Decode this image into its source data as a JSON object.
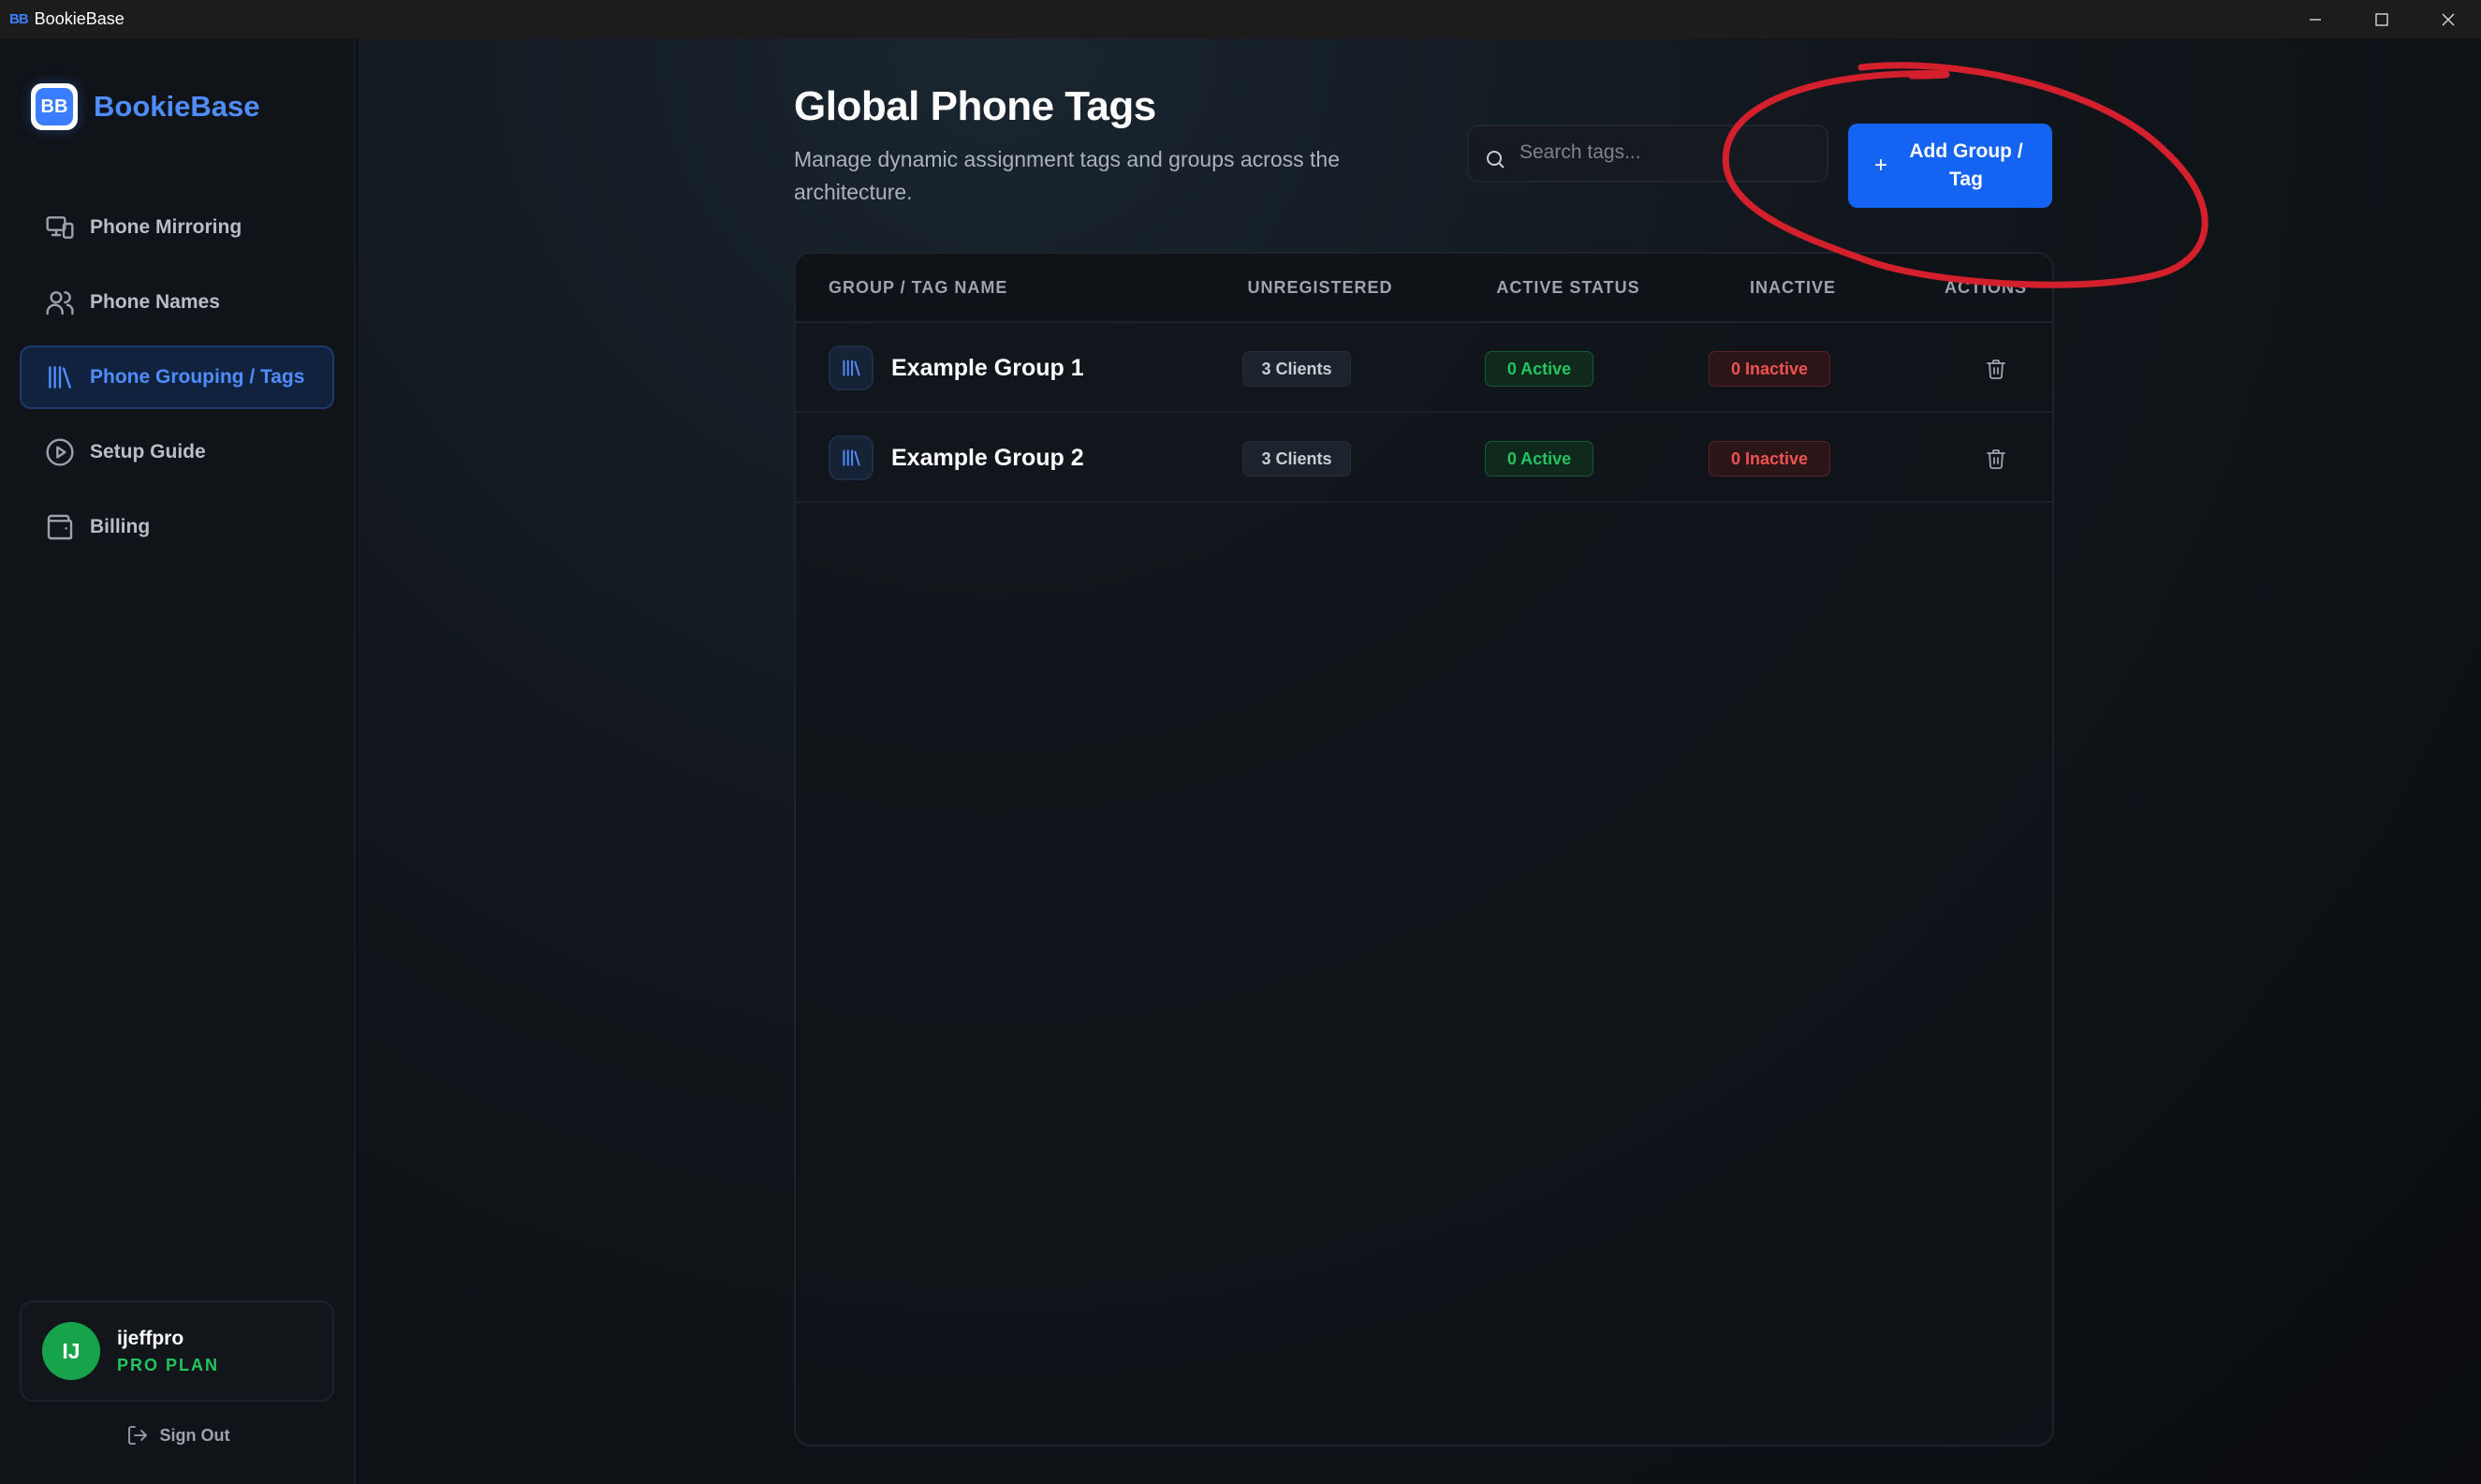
{
  "window": {
    "logo_text": "BB",
    "title": "BookieBase"
  },
  "sidebar": {
    "brand_badge": "BB",
    "brand_name": "BookieBase",
    "items": [
      {
        "label": "Phone Mirroring",
        "icon": "devices-icon",
        "active": false
      },
      {
        "label": "Phone Names",
        "icon": "users-icon",
        "active": false
      },
      {
        "label": "Phone Grouping / Tags",
        "icon": "library-icon",
        "active": true
      },
      {
        "label": "Setup Guide",
        "icon": "play-circle-icon",
        "active": false
      },
      {
        "label": "Billing",
        "icon": "wallet-icon",
        "active": false
      }
    ],
    "user": {
      "initials": "IJ",
      "name": "ijeffpro",
      "plan": "PRO PLAN"
    },
    "sign_out": "Sign Out"
  },
  "main": {
    "title": "Global Phone Tags",
    "subtitle": "Manage dynamic assignment tags and groups across the architecture.",
    "search_placeholder": "Search tags...",
    "add_button": "Add Group /\nTag",
    "table": {
      "columns": [
        "GROUP / TAG NAME",
        "UNREGISTERED",
        "ACTIVE STATUS",
        "INACTIVE",
        "ACTIONS"
      ],
      "rows": [
        {
          "name": "Example Group 1",
          "unregistered": "3 Clients",
          "active": "0 Active",
          "inactive": "0 Inactive"
        },
        {
          "name": "Example Group 2",
          "unregistered": "3 Clients",
          "active": "0 Active",
          "inactive": "0 Inactive"
        }
      ]
    }
  },
  "colors": {
    "accent": "#1463f3",
    "brand": "#4f8dff",
    "active_green": "#22c55e",
    "inactive_red": "#f05252",
    "annotation_red": "#d4202c"
  }
}
